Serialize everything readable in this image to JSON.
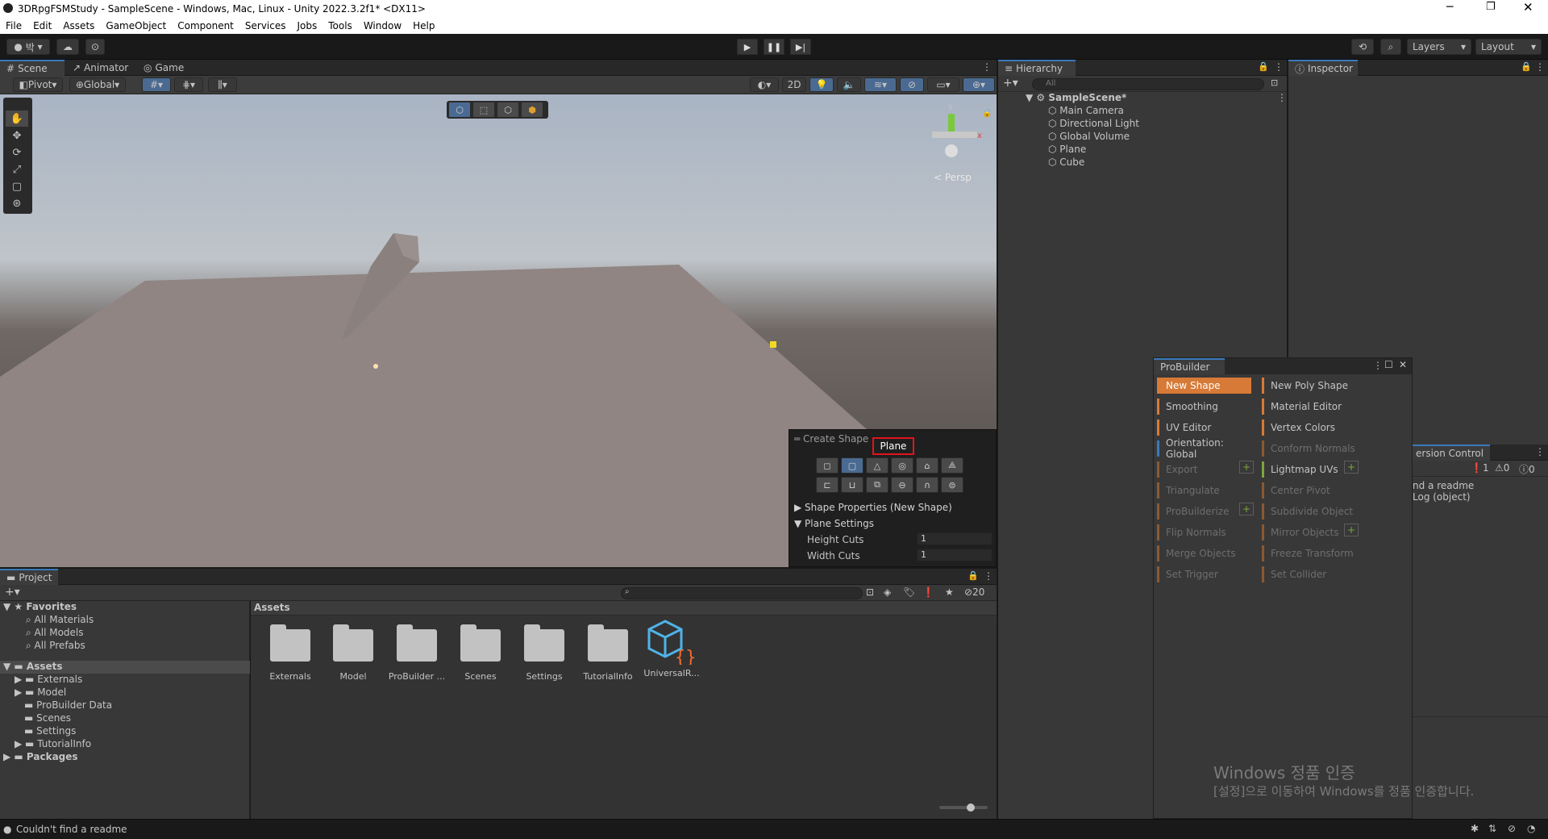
{
  "window": {
    "title": "3DRpgFSMStudy - SampleScene - Windows, Mac, Linux - Unity 2022.3.2f1* <DX11>"
  },
  "menu": [
    "File",
    "Edit",
    "Assets",
    "GameObject",
    "Component",
    "Services",
    "Jobs",
    "Tools",
    "Window",
    "Help"
  ],
  "toolbar": {
    "account": "박",
    "layers": "Layers",
    "layout": "Layout"
  },
  "scene_tabs": [
    "Scene",
    "Animator",
    "Game"
  ],
  "scene_toolbar": {
    "pivot": "Pivot",
    "global": "Global",
    "mode_2d": "2D"
  },
  "gizmo": {
    "y": "y",
    "x": "x",
    "persp": "Persp"
  },
  "create_shape": {
    "title": "Create Shape",
    "selected": "Plane",
    "shape_properties": "Shape Properties (New Shape)",
    "plane_settings": "Plane Settings",
    "height_cuts_label": "Height Cuts",
    "height_cuts_value": "1",
    "width_cuts_label": "Width Cuts",
    "width_cuts_value": "1"
  },
  "hierarchy": {
    "tab": "Hierarchy",
    "search_placeholder": "All",
    "scene": "SampleScene*",
    "items": [
      "Main Camera",
      "Directional Light",
      "Global Volume",
      "Plane",
      "Cube"
    ]
  },
  "inspector": {
    "tab": "Inspector"
  },
  "probuilder": {
    "title": "ProBuilder",
    "left": [
      "New Shape",
      "Smoothing",
      "UV Editor",
      "Orientation: Global",
      "Export",
      "Triangulate",
      "ProBuilderize",
      "Flip Normals",
      "Merge Objects",
      "Set Trigger"
    ],
    "right": [
      "New Poly Shape",
      "Material Editor",
      "Vertex Colors",
      "Conform Normals",
      "Lightmap UVs",
      "Center Pivot",
      "Subdivide Object",
      "Mirror Objects",
      "Freeze Transform",
      "Set Collider"
    ]
  },
  "version_control": {
    "tab": "ersion Control",
    "errors": "1",
    "warnings": "0",
    "messages": "0",
    "line1": "nd a readme",
    "line2": "Log (object)"
  },
  "project": {
    "tab": "Project",
    "favorites": "Favorites",
    "fav_items": [
      "All Materials",
      "All Models",
      "All Prefabs"
    ],
    "assets_root": "Assets",
    "asset_tree": [
      "Externals",
      "Model",
      "ProBuilder Data",
      "Scenes",
      "Settings",
      "TutorialInfo"
    ],
    "packages": "Packages",
    "assets_header": "Assets",
    "hidden_count": "20",
    "asset_items": [
      "Externals",
      "Model",
      "ProBuilder ...",
      "Scenes",
      "Settings",
      "TutorialInfo",
      "UniversalR..."
    ]
  },
  "watermark": {
    "line1": "Windows 정품 인증",
    "line2": "[설정]으로 이동하여 Windows를 정품 인증합니다."
  },
  "status": {
    "message": "Couldn't find a readme"
  },
  "colors": {
    "accent": "#3a79bb",
    "probuilder_orange": "#d77a37",
    "probuilder_green": "#7aa83b",
    "highlight_red": "#e0141e"
  }
}
